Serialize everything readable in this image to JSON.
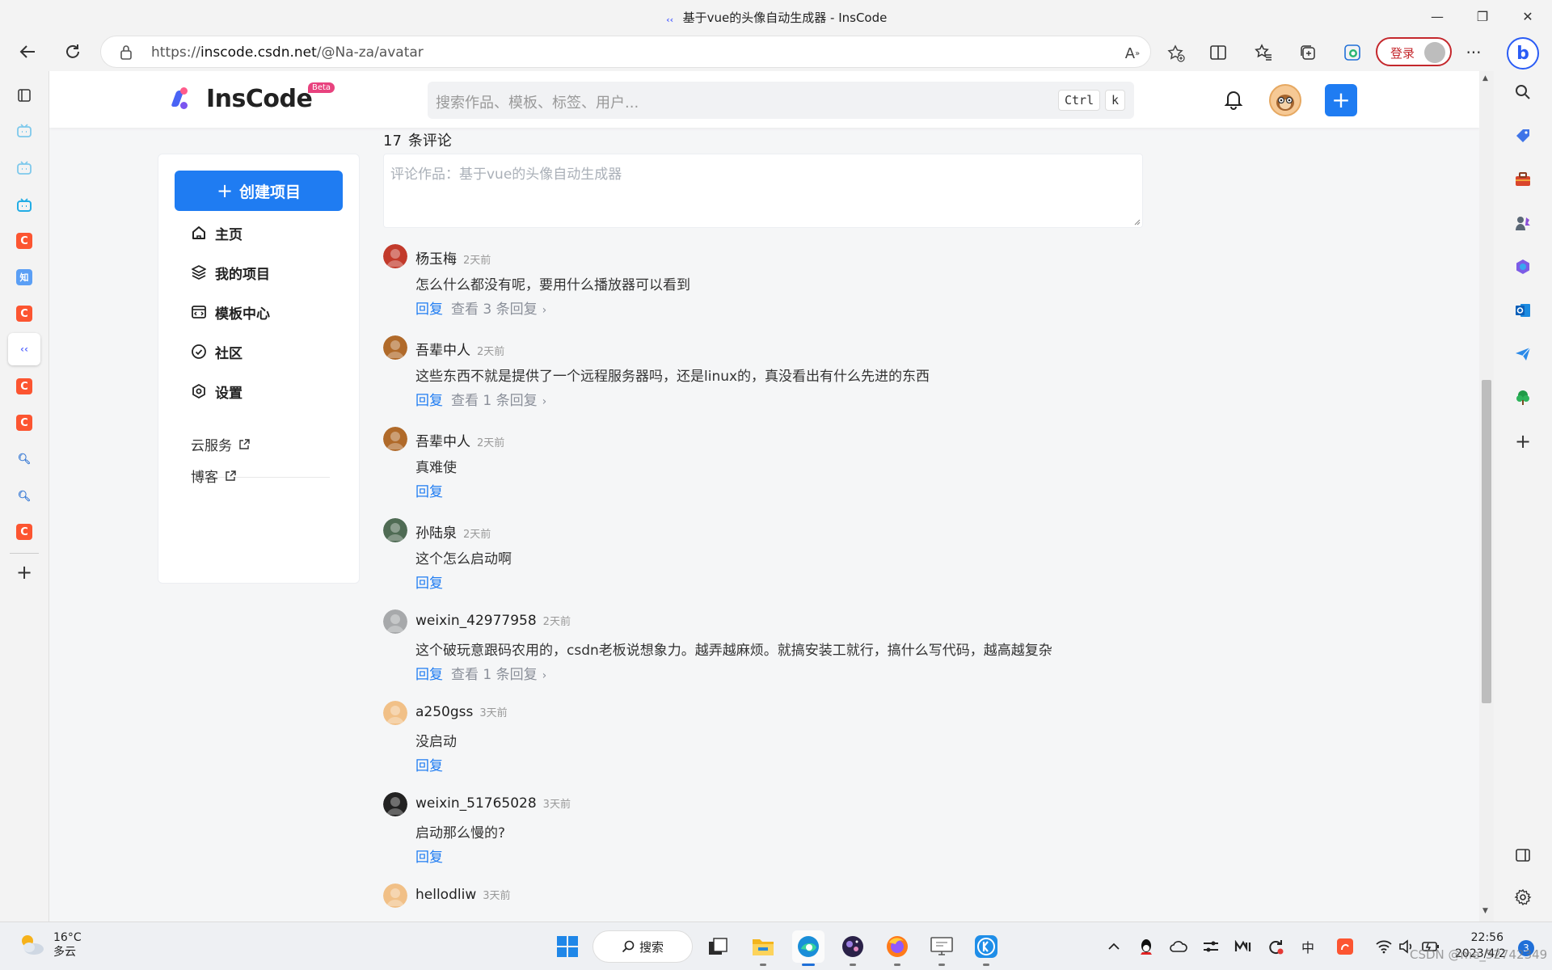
{
  "window": {
    "title": "基于vue的头像自动生成器 - InsCode",
    "minimize": "—",
    "maximize": "❐",
    "close": "✕"
  },
  "browser": {
    "url_prefix": "https://",
    "url_host": "inscode.csdn.net",
    "url_path": "/@Na-za/avatar",
    "login_label": "登录"
  },
  "site": {
    "logo_name": "InsCode",
    "beta": "Beta",
    "search_placeholder": "搜索作品、模板、标签、用户...",
    "kbd1": "Ctrl",
    "kbd2": "k",
    "plus": "+"
  },
  "sidebar": {
    "create_label": "创建项目",
    "create_plus": "+",
    "items": [
      {
        "label": "主页",
        "icon": "home-icon"
      },
      {
        "label": "我的项目",
        "icon": "layers-icon"
      },
      {
        "label": "模板中心",
        "icon": "template-icon"
      },
      {
        "label": "社区",
        "icon": "community-icon"
      },
      {
        "label": "设置",
        "icon": "settings-icon"
      }
    ],
    "links": [
      {
        "label": "云服务"
      },
      {
        "label": "博客"
      }
    ]
  },
  "comments": {
    "count": "17",
    "count_label": "条评论",
    "input_placeholder": "评论作品：基于vue的头像自动生成器",
    "reply_label": "回复",
    "items": [
      {
        "user": "杨玉梅",
        "time": "2天前",
        "text": "怎么什么都没有呢，要用什么播放器可以看到",
        "more": "查看 3 条回复",
        "avatar_color": "#c23a2b"
      },
      {
        "user": "吾辈中人",
        "time": "2天前",
        "text": "这些东西不就是提供了一个远程服务器吗，还是linux的，真没看出有什么先进的东西",
        "more": "查看 1 条回复",
        "avatar_color": "#b06a2a"
      },
      {
        "user": "吾辈中人",
        "time": "2天前",
        "text": "真难使",
        "more": "",
        "avatar_color": "#b06a2a"
      },
      {
        "user": "孙陆泉",
        "time": "2天前",
        "text": "这个怎么启动啊",
        "more": "",
        "avatar_color": "#4f6b54"
      },
      {
        "user": "weixin_42977958",
        "time": "2天前",
        "text": "这个破玩意跟码农用的，csdn老板说想象力。越弄越麻烦。就搞安装工就行，搞什么写代码，越高越复杂",
        "more": "查看 1 条回复",
        "avatar_color": "#a7a9ab"
      },
      {
        "user": "a250gss",
        "time": "3天前",
        "text": "没启动",
        "more": "",
        "avatar_color": "#f1c087"
      },
      {
        "user": "weixin_51765028",
        "time": "3天前",
        "text": "启动那么慢的?",
        "more": "",
        "avatar_color": "#222222"
      },
      {
        "user": "hellodliw",
        "time": "3天前",
        "text": "",
        "more": "",
        "avatar_color": "#f1c087"
      }
    ]
  },
  "taskbar": {
    "temp": "16°C",
    "weather": "多云",
    "search_label": "搜索",
    "time": "22:56",
    "date": "2023/4/2",
    "notif_count": "3",
    "ime": "中"
  },
  "watermark": "CSDN @me_52742349",
  "colors": {
    "accent": "#1f7cf2",
    "csdn_red": "#fc5531",
    "login_red": "#c4272c"
  }
}
